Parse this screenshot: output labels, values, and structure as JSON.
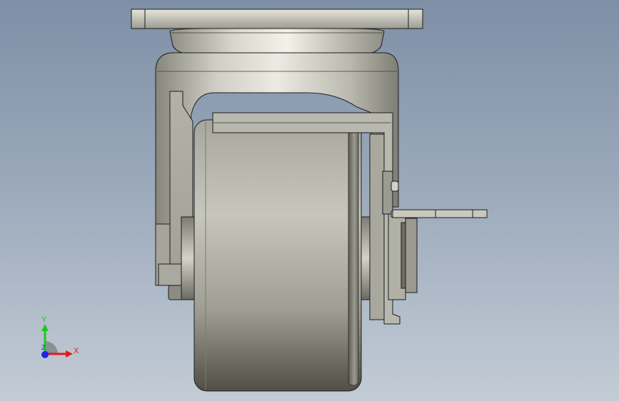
{
  "viewport": {
    "background_top": "#7e8fa6",
    "background_bottom": "#c3ccd6",
    "part_color": "#c4c4b8"
  },
  "triad": {
    "x_label": "X",
    "y_label": "Y",
    "z_label": "Z",
    "x_color": "#e01a1a",
    "y_color": "#1ec81e",
    "z_color": "#1a28e0"
  }
}
